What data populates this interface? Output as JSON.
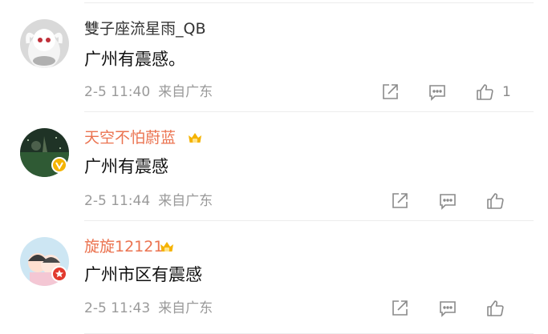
{
  "comments": [
    {
      "username": "雙子座流星雨_QB",
      "text": "广州有震感。",
      "time": "2-5 11:40",
      "location": "来自广东",
      "like_count": "1",
      "avatar": "white-creature-avatar"
    },
    {
      "username": "天空不怕蔚蓝",
      "text": "广州有震感",
      "time": "2-5 11:44",
      "location": "来自广东",
      "verified_badge": "yellow-verified",
      "avatar": "night-scene-avatar"
    },
    {
      "username": "旋旋12121",
      "text": "广州市区有震感",
      "time": "2-5 11:43",
      "location": "来自广东",
      "verified_badge": "red-verified",
      "avatar": "cartoon-couple-avatar"
    }
  ],
  "colors": {
    "vip_name": "#eb7350",
    "meta": "#9a9a9a",
    "text": "#111111",
    "icon": "#8a8a8a"
  }
}
